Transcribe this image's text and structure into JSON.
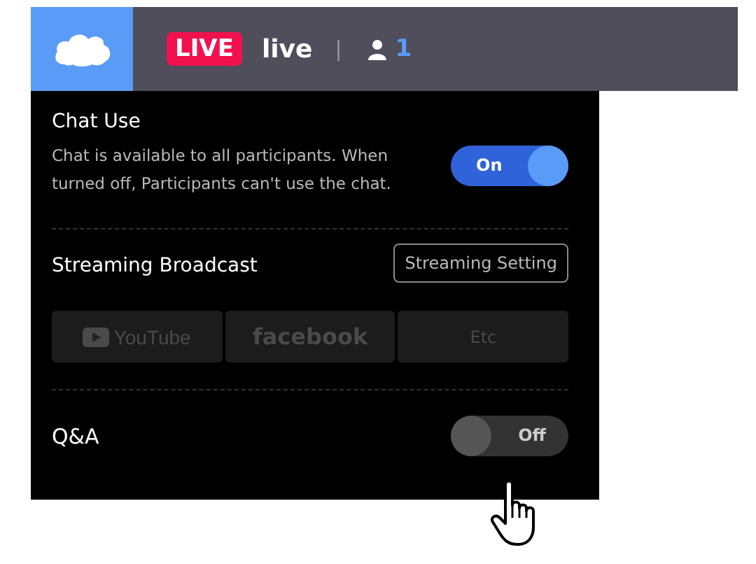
{
  "header": {
    "badge": "LIVE",
    "title": "live",
    "separator": "|",
    "viewer_count": "1"
  },
  "chat": {
    "title": "Chat Use",
    "description": "Chat is available to all participants. When turned off, Participants can't use the chat.",
    "toggle": {
      "label": "On",
      "on": true
    }
  },
  "streaming": {
    "title": "Streaming Broadcast",
    "setting_button": "Streaming Setting",
    "platforms": [
      {
        "label": "YouTube",
        "kind": "video"
      },
      {
        "label": "facebook",
        "kind": "wordmark"
      },
      {
        "label": "Etc",
        "kind": "plain"
      }
    ]
  },
  "qa": {
    "title": "Q&A",
    "toggle": {
      "label": "Off",
      "on": false
    }
  }
}
